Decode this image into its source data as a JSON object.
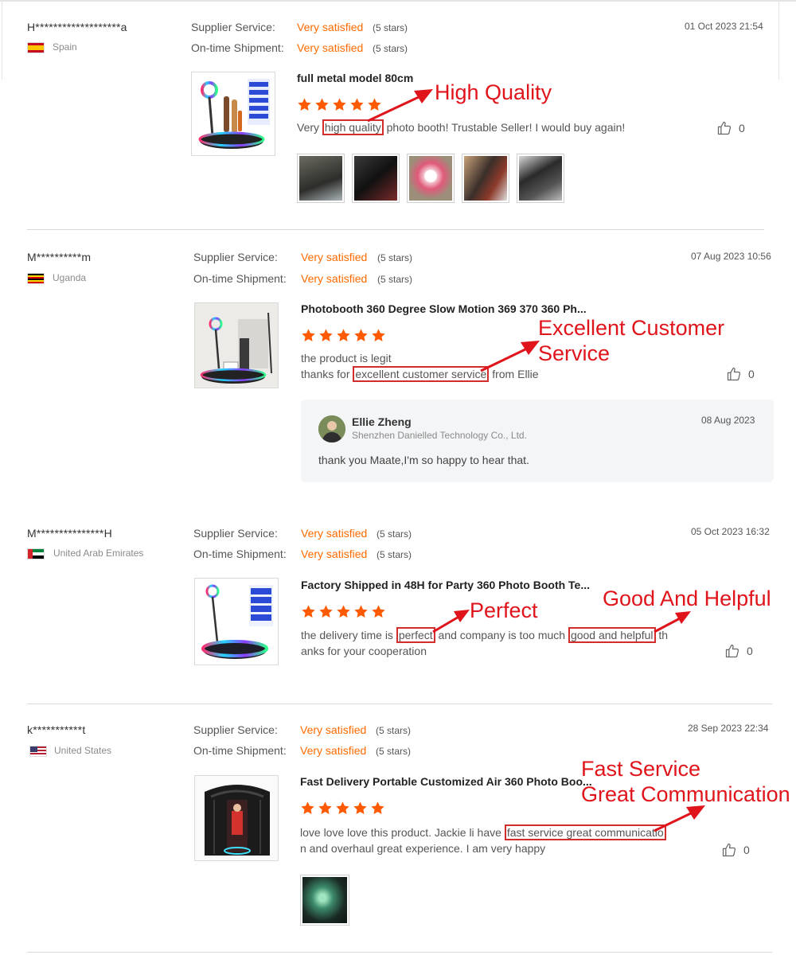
{
  "reviews": [
    {
      "user": "H*******************a",
      "country": "Spain",
      "supplier_label": "Supplier Service:",
      "supplier_value": "Very satisfied",
      "supplier_stars": "(5 stars)",
      "shipment_label": "On-time Shipment:",
      "shipment_value": "Very satisfied",
      "shipment_stars": "(5 stars)",
      "date": "01 Oct 2023 21:54",
      "product_title": "full metal model 80cm",
      "rating": 5,
      "text_line1_before": "Very ",
      "text_line1_hl": "high quality",
      "text_line1_after": " photo booth! Trustable Seller! I would buy again!",
      "likes": "0",
      "annotation": "High Quality",
      "photo_count": 5
    },
    {
      "user": "M**********m",
      "country": "Uganda",
      "supplier_label": "Supplier Service:",
      "supplier_value": "Very satisfied",
      "supplier_stars": "(5 stars)",
      "shipment_label": "On-time Shipment:",
      "shipment_value": "Very satisfied",
      "shipment_stars": "(5 stars)",
      "date": "07 Aug 2023 10:56",
      "product_title": "Photobooth 360 Degree Slow Motion 369 370 360 Ph...",
      "rating": 5,
      "text_line1": "the product is legit",
      "text_line2_before": "thanks for ",
      "text_line2_hl": "excellent customer service",
      "text_line2_after": " from Ellie",
      "likes": "0",
      "annotation_line1": "Excellent Customer",
      "annotation_line2": "Service",
      "reply": {
        "seller_name": "Ellie Zheng",
        "company": "Shenzhen Danielled Technology Co., Ltd.",
        "date": "08 Aug 2023",
        "text": "thank you Maate,I'm so happy to hear that."
      }
    },
    {
      "user": "M***************H",
      "country": "United Arab Emirates",
      "supplier_label": "Supplier Service:",
      "supplier_value": "Very satisfied",
      "supplier_stars": "(5 stars)",
      "shipment_label": "On-time Shipment:",
      "shipment_value": "Very satisfied",
      "shipment_stars": "(5 stars)",
      "date": "05 Oct 2023 16:32",
      "product_title": "Factory Shipped in 48H for Party 360 Photo Booth Te...",
      "rating": 5,
      "text_line1_a": "the delivery time is ",
      "text_line1_hl1": "perfect",
      "text_line1_b": " and company is too much ",
      "text_line1_hl2": "good and helpful",
      "text_line1_c": " th",
      "text_line2": "anks for your cooperation",
      "likes": "0",
      "annotation_a": "Perfect",
      "annotation_b": "Good And Helpful"
    },
    {
      "user": "k***********t",
      "country": "United States",
      "supplier_label": "Supplier Service:",
      "supplier_value": "Very satisfied",
      "supplier_stars": "(5 stars)",
      "shipment_label": "On-time Shipment:",
      "shipment_value": "Very satisfied",
      "shipment_stars": "(5 stars)",
      "date": "28 Sep 2023 22:34",
      "product_title": "Fast Delivery Portable Customized Air 360 Photo Boo...",
      "rating": 5,
      "text_line1_before": "love love love this product. Jackie li have ",
      "text_line1_hl": "fast service great communicatio",
      "text_line2": "n and overhaul great experience. I am very happy",
      "likes": "0",
      "annotation_line1": "Fast Service",
      "annotation_line2": "Great Communication",
      "photo_count": 1
    }
  ],
  "colors": {
    "accent": "#ff6a00",
    "annotation": "#e0141b",
    "highlight_box": "#d32c2c"
  },
  "icons": [
    "star-icon",
    "thumbs-up-icon",
    "flag-icon",
    "avatar"
  ]
}
